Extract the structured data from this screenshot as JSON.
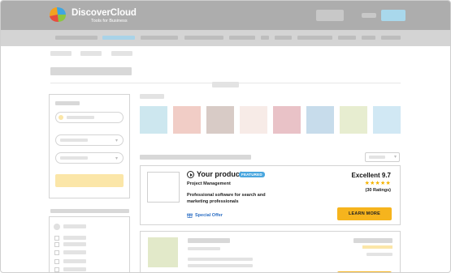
{
  "header": {
    "brand": "DiscoverCloud",
    "tagline": "Tools for Business",
    "logo_colors": [
      "#f3a21f",
      "#3fa6e0",
      "#8cc63f",
      "#e84c3d"
    ]
  },
  "swatches": [
    "#cde7ef",
    "#f1cdc6",
    "#d8cbc6",
    "#f7ebe7",
    "#e9c2c7",
    "#c7dceb",
    "#e7edd0",
    "#d1e8f4"
  ],
  "product": {
    "name": "Your product",
    "badge": "FEATURED",
    "category": "Project Management",
    "description": "Professional software for search and marketing professionals",
    "offer": "Special Offer",
    "score": "Excellent 9.7",
    "rating_stars": 5,
    "ratings": "(30 Ratings)",
    "cta": "LEARN MORE"
  },
  "colors": {
    "accent": "#f6b41d",
    "link": "#2d6fc4",
    "badge": "#4aa7df",
    "star": "#f5b300"
  }
}
